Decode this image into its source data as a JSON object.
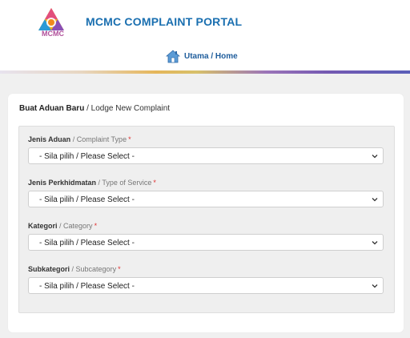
{
  "header": {
    "logo_text": "MCMC",
    "portal_title": "MCMC COMPLAINT PORTAL",
    "home_link": "Utama / Home",
    "home_icon": "home-icon",
    "accent": "#1a6fb0"
  },
  "card": {
    "title_bold": "Buat Aduan Baru",
    "title_rest": " / Lodge New Complaint"
  },
  "form": {
    "fields": [
      {
        "label_main": "Jenis Aduan",
        "label_sep": " / ",
        "label_sub": "Complaint Type",
        "required": "*",
        "value": "- Sila pilih / Please Select -"
      },
      {
        "label_main": "Jenis Perkhidmatan",
        "label_sep": " / ",
        "label_sub": "Type of Service",
        "required": "*",
        "value": "- Sila pilih / Please Select -"
      },
      {
        "label_main": "Kategori",
        "label_sep": " / ",
        "label_sub": "Category",
        "required": "*",
        "value": "- Sila pilih / Please Select -"
      },
      {
        "label_main": "Subkategori",
        "label_sep": " / ",
        "label_sub": "Subcategory",
        "required": "*",
        "value": "- Sila pilih / Please Select -"
      }
    ]
  },
  "colors": {
    "required": "#e03131",
    "link": "#1f5d9c"
  }
}
